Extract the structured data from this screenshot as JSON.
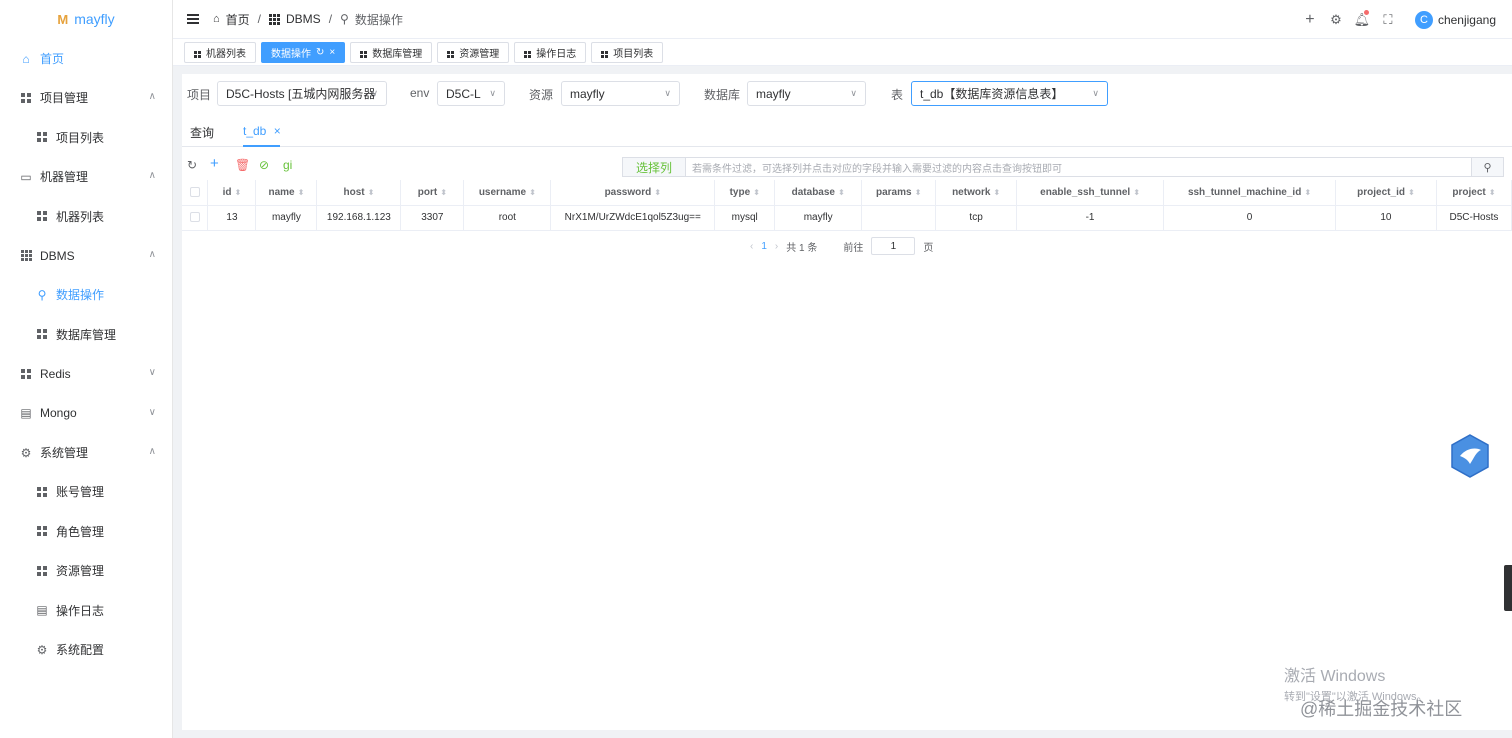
{
  "app": {
    "logo_mark": "M",
    "logo_text": "mayfly"
  },
  "sidebar": {
    "items": [
      {
        "label": "首页",
        "icon": "home-icon",
        "level": 0,
        "active": true
      },
      {
        "label": "项目管理",
        "icon": "grid-icon",
        "level": 0,
        "arrow": "∧"
      },
      {
        "label": "项目列表",
        "icon": "grid-icon",
        "level": 1
      },
      {
        "label": "机器管理",
        "icon": "monitor-icon",
        "level": 0,
        "arrow": "∧"
      },
      {
        "label": "机器列表",
        "icon": "grid-icon",
        "level": 1
      },
      {
        "label": "DBMS",
        "icon": "apps-icon",
        "level": 0,
        "arrow": "∧"
      },
      {
        "label": "数据操作",
        "icon": "search-icon",
        "level": 1,
        "active": true
      },
      {
        "label": "数据库管理",
        "icon": "grid-icon",
        "level": 1
      },
      {
        "label": "Redis",
        "icon": "grid-icon",
        "level": 0,
        "arrow": "∨"
      },
      {
        "label": "Mongo",
        "icon": "document-icon",
        "level": 0,
        "arrow": "∨"
      },
      {
        "label": "系统管理",
        "icon": "gear-icon",
        "level": 0,
        "arrow": "∧"
      },
      {
        "label": "账号管理",
        "icon": "grid-icon",
        "level": 1
      },
      {
        "label": "角色管理",
        "icon": "grid-icon",
        "level": 1
      },
      {
        "label": "资源管理",
        "icon": "grid-icon",
        "level": 1
      },
      {
        "label": "操作日志",
        "icon": "document-icon",
        "level": 1
      },
      {
        "label": "系统配置",
        "icon": "gear-icon",
        "level": 1
      }
    ]
  },
  "header": {
    "breadcrumbs": [
      "首页",
      "DBMS",
      "数据操作"
    ],
    "user": {
      "initial": "C",
      "name": "chenjigang"
    }
  },
  "tags": [
    {
      "label": "机器列表"
    },
    {
      "label": "数据操作",
      "active": true
    },
    {
      "label": "数据库管理"
    },
    {
      "label": "资源管理"
    },
    {
      "label": "操作日志"
    },
    {
      "label": "项目列表"
    }
  ],
  "filter": {
    "project_label": "项目",
    "project_value": "D5C-Hosts [五城内网服务器",
    "env_label": "env",
    "env_value": "D5C-L",
    "resource_label": "资源",
    "resource_value": "mayfly",
    "database_label": "数据库",
    "database_value": "mayfly",
    "table_label": "表",
    "table_value": "t_db【数据库资源信息表】"
  },
  "subtabs": {
    "query": "查询",
    "table_tab": "t_db"
  },
  "toolbar": {
    "gi_text": "gi",
    "select_columns": "选择列",
    "condition_placeholder": "若需条件过滤，可选择列并点击对应的字段并输入需要过滤的内容点击查询按钮即可"
  },
  "table": {
    "columns": [
      "id",
      "name",
      "host",
      "port",
      "username",
      "password",
      "type",
      "database",
      "params",
      "network",
      "enable_ssh_tunnel",
      "ssh_tunnel_machine_id",
      "project_id",
      "project"
    ],
    "rows": [
      [
        "13",
        "mayfly",
        "192.168.1.123",
        "3307",
        "root",
        "NrX1M/UrZWdcE1qol5Z3ug==",
        "mysql",
        "mayfly",
        "",
        "tcp",
        "-1",
        "0",
        "10",
        "D5C-Hosts"
      ]
    ]
  },
  "pagination": {
    "current_page": "1",
    "total": "共 1 条",
    "goto_label": "前往",
    "goto_value": "1",
    "page_suffix": "页"
  },
  "watermark": {
    "line1": "激活 Windows",
    "line2": "转到\"设置\"以激活 Windows。",
    "line3": "@稀土掘金技术社区"
  },
  "colors": {
    "primary": "#409eff",
    "success": "#67c23a",
    "danger": "#f56c6c"
  }
}
